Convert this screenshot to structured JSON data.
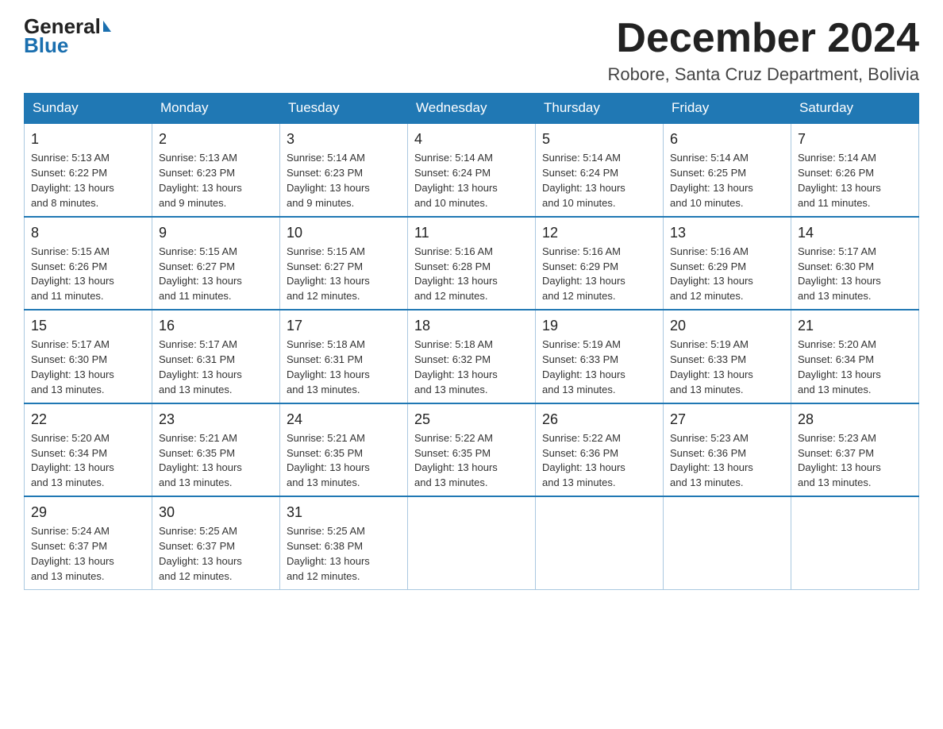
{
  "logo": {
    "general": "General",
    "blue": "Blue",
    "arrow": "▶"
  },
  "header": {
    "title": "December 2024",
    "subtitle": "Robore, Santa Cruz Department, Bolivia"
  },
  "days_of_week": [
    "Sunday",
    "Monday",
    "Tuesday",
    "Wednesday",
    "Thursday",
    "Friday",
    "Saturday"
  ],
  "weeks": [
    [
      {
        "day": "1",
        "sunrise": "5:13 AM",
        "sunset": "6:22 PM",
        "daylight": "13 hours and 8 minutes."
      },
      {
        "day": "2",
        "sunrise": "5:13 AM",
        "sunset": "6:23 PM",
        "daylight": "13 hours and 9 minutes."
      },
      {
        "day": "3",
        "sunrise": "5:14 AM",
        "sunset": "6:23 PM",
        "daylight": "13 hours and 9 minutes."
      },
      {
        "day": "4",
        "sunrise": "5:14 AM",
        "sunset": "6:24 PM",
        "daylight": "13 hours and 10 minutes."
      },
      {
        "day": "5",
        "sunrise": "5:14 AM",
        "sunset": "6:24 PM",
        "daylight": "13 hours and 10 minutes."
      },
      {
        "day": "6",
        "sunrise": "5:14 AM",
        "sunset": "6:25 PM",
        "daylight": "13 hours and 10 minutes."
      },
      {
        "day": "7",
        "sunrise": "5:14 AM",
        "sunset": "6:26 PM",
        "daylight": "13 hours and 11 minutes."
      }
    ],
    [
      {
        "day": "8",
        "sunrise": "5:15 AM",
        "sunset": "6:26 PM",
        "daylight": "13 hours and 11 minutes."
      },
      {
        "day": "9",
        "sunrise": "5:15 AM",
        "sunset": "6:27 PM",
        "daylight": "13 hours and 11 minutes."
      },
      {
        "day": "10",
        "sunrise": "5:15 AM",
        "sunset": "6:27 PM",
        "daylight": "13 hours and 12 minutes."
      },
      {
        "day": "11",
        "sunrise": "5:16 AM",
        "sunset": "6:28 PM",
        "daylight": "13 hours and 12 minutes."
      },
      {
        "day": "12",
        "sunrise": "5:16 AM",
        "sunset": "6:29 PM",
        "daylight": "13 hours and 12 minutes."
      },
      {
        "day": "13",
        "sunrise": "5:16 AM",
        "sunset": "6:29 PM",
        "daylight": "13 hours and 12 minutes."
      },
      {
        "day": "14",
        "sunrise": "5:17 AM",
        "sunset": "6:30 PM",
        "daylight": "13 hours and 13 minutes."
      }
    ],
    [
      {
        "day": "15",
        "sunrise": "5:17 AM",
        "sunset": "6:30 PM",
        "daylight": "13 hours and 13 minutes."
      },
      {
        "day": "16",
        "sunrise": "5:17 AM",
        "sunset": "6:31 PM",
        "daylight": "13 hours and 13 minutes."
      },
      {
        "day": "17",
        "sunrise": "5:18 AM",
        "sunset": "6:31 PM",
        "daylight": "13 hours and 13 minutes."
      },
      {
        "day": "18",
        "sunrise": "5:18 AM",
        "sunset": "6:32 PM",
        "daylight": "13 hours and 13 minutes."
      },
      {
        "day": "19",
        "sunrise": "5:19 AM",
        "sunset": "6:33 PM",
        "daylight": "13 hours and 13 minutes."
      },
      {
        "day": "20",
        "sunrise": "5:19 AM",
        "sunset": "6:33 PM",
        "daylight": "13 hours and 13 minutes."
      },
      {
        "day": "21",
        "sunrise": "5:20 AM",
        "sunset": "6:34 PM",
        "daylight": "13 hours and 13 minutes."
      }
    ],
    [
      {
        "day": "22",
        "sunrise": "5:20 AM",
        "sunset": "6:34 PM",
        "daylight": "13 hours and 13 minutes."
      },
      {
        "day": "23",
        "sunrise": "5:21 AM",
        "sunset": "6:35 PM",
        "daylight": "13 hours and 13 minutes."
      },
      {
        "day": "24",
        "sunrise": "5:21 AM",
        "sunset": "6:35 PM",
        "daylight": "13 hours and 13 minutes."
      },
      {
        "day": "25",
        "sunrise": "5:22 AM",
        "sunset": "6:35 PM",
        "daylight": "13 hours and 13 minutes."
      },
      {
        "day": "26",
        "sunrise": "5:22 AM",
        "sunset": "6:36 PM",
        "daylight": "13 hours and 13 minutes."
      },
      {
        "day": "27",
        "sunrise": "5:23 AM",
        "sunset": "6:36 PM",
        "daylight": "13 hours and 13 minutes."
      },
      {
        "day": "28",
        "sunrise": "5:23 AM",
        "sunset": "6:37 PM",
        "daylight": "13 hours and 13 minutes."
      }
    ],
    [
      {
        "day": "29",
        "sunrise": "5:24 AM",
        "sunset": "6:37 PM",
        "daylight": "13 hours and 13 minutes."
      },
      {
        "day": "30",
        "sunrise": "5:25 AM",
        "sunset": "6:37 PM",
        "daylight": "13 hours and 12 minutes."
      },
      {
        "day": "31",
        "sunrise": "5:25 AM",
        "sunset": "6:38 PM",
        "daylight": "13 hours and 12 minutes."
      },
      null,
      null,
      null,
      null
    ]
  ],
  "labels": {
    "sunrise": "Sunrise:",
    "sunset": "Sunset:",
    "daylight": "Daylight:"
  }
}
